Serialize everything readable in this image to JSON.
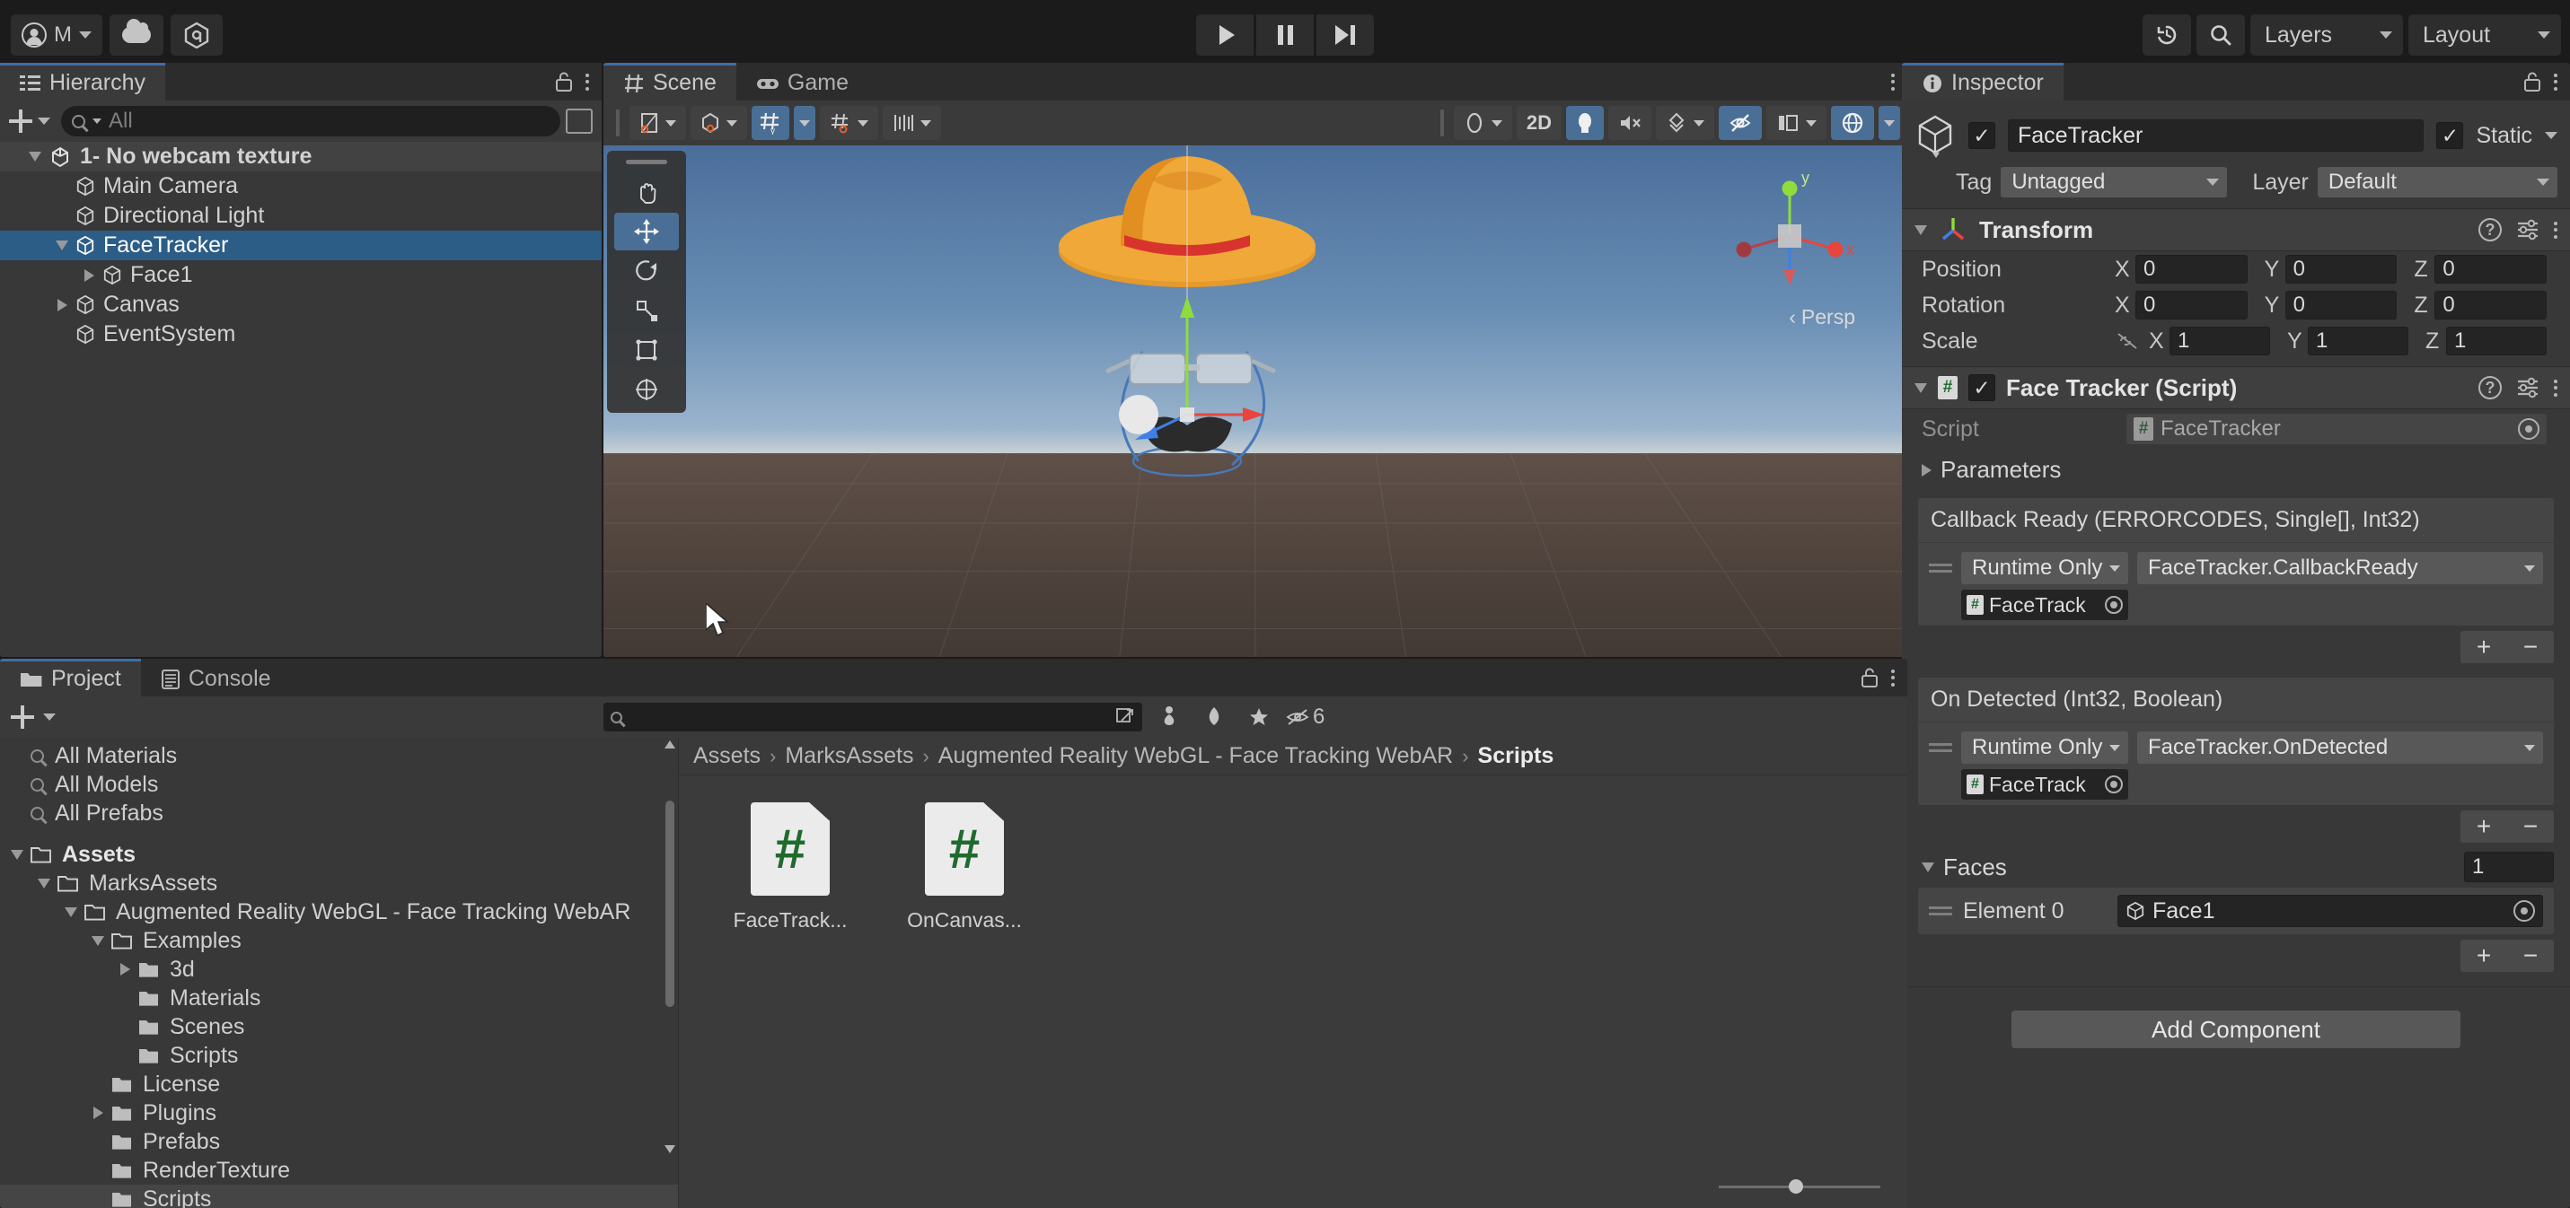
{
  "toolbar": {
    "account_label": "M",
    "account_icon": "user-avatar-icon",
    "cloud_icon": "cloud-icon",
    "services_icon": "unity-services-icon",
    "play_icon": "play-icon",
    "pause_icon": "pause-icon",
    "step_icon": "step-icon",
    "history_icon": "undo-history-icon",
    "search_icon": "search-icon",
    "layers_label": "Layers",
    "layout_label": "Layout"
  },
  "hierarchy": {
    "tab_label": "Hierarchy",
    "tab_icon": "hierarchy-icon",
    "lock_icon": "lock-icon",
    "menu_icon": "kebab-menu-icon",
    "add_icon": "plus-icon",
    "search_placeholder": "All",
    "search_value": "",
    "items": [
      {
        "label": "1- No webcam texture",
        "depth": 0,
        "icon": "unity-scene-icon",
        "expand": "down",
        "selected": false,
        "is_scene": true
      },
      {
        "label": "Main Camera",
        "depth": 1,
        "icon": "gameobject-icon",
        "expand": "none",
        "selected": false,
        "is_scene": false
      },
      {
        "label": "Directional Light",
        "depth": 1,
        "icon": "gameobject-icon",
        "expand": "none",
        "selected": false,
        "is_scene": false
      },
      {
        "label": "FaceTracker",
        "depth": 1,
        "icon": "gameobject-icon",
        "expand": "down",
        "selected": true,
        "is_scene": false
      },
      {
        "label": "Face1",
        "depth": 2,
        "icon": "gameobject-icon",
        "expand": "right",
        "selected": false,
        "is_scene": false
      },
      {
        "label": "Canvas",
        "depth": 1,
        "icon": "gameobject-icon",
        "expand": "right",
        "selected": false,
        "is_scene": false
      },
      {
        "label": "EventSystem",
        "depth": 1,
        "icon": "gameobject-icon",
        "expand": "none",
        "selected": false,
        "is_scene": false
      }
    ]
  },
  "scene": {
    "tabs": [
      {
        "label": "Scene",
        "icon": "scene-grid-icon",
        "active": true
      },
      {
        "label": "Game",
        "icon": "game-controller-icon",
        "active": false
      }
    ],
    "menu_icon": "kebab-menu-icon",
    "left_tools": [
      {
        "name": "hand-tool",
        "active": false
      },
      {
        "name": "move-tool",
        "active": true
      },
      {
        "name": "rotate-tool",
        "active": false
      },
      {
        "name": "scale-tool",
        "active": false
      },
      {
        "name": "rect-tool",
        "active": false
      },
      {
        "name": "transform-tool",
        "active": false
      }
    ],
    "toolbar_left": [
      {
        "name": "tool-settings-pivot",
        "active": false,
        "has_caret": true
      },
      {
        "name": "tool-settings-handle",
        "active": false,
        "has_caret": true
      },
      {
        "name": "grid-snapping",
        "active": true,
        "has_caret": true
      },
      {
        "name": "grid-visibility",
        "active": false,
        "has_caret": true
      },
      {
        "name": "snap-increment",
        "active": false,
        "has_caret": true
      }
    ],
    "toolbar_right": [
      {
        "name": "draw-mode",
        "active": false,
        "has_caret": true
      },
      {
        "name": "2d-toggle",
        "label": "2D",
        "active": false,
        "has_caret": false
      },
      {
        "name": "scene-lighting",
        "active": true,
        "has_caret": false
      },
      {
        "name": "scene-audio",
        "active": false,
        "has_caret": false
      },
      {
        "name": "effects-toggle",
        "active": false,
        "has_caret": true
      },
      {
        "name": "hidden-objects",
        "active": true,
        "has_caret": false
      },
      {
        "name": "scene-camera",
        "active": false,
        "has_caret": true
      },
      {
        "name": "gizmos-toggle",
        "active": true,
        "has_caret": true
      }
    ],
    "gizmo": {
      "x_label": "x",
      "y_label": "y",
      "persp_label": "Persp"
    }
  },
  "inspector": {
    "tab_label": "Inspector",
    "tab_icon": "info-icon",
    "lock_icon": "lock-icon",
    "menu_icon": "kebab-menu-icon",
    "object_icon": "gameobject-icon",
    "object_enabled": true,
    "object_name": "FaceTracker",
    "static_label": "Static",
    "static_checked": true,
    "tag_label": "Tag",
    "tag_value": "Untagged",
    "layer_label": "Layer",
    "layer_value": "Default",
    "transform": {
      "title": "Transform",
      "icon": "transform-axis-icon",
      "help_icon": "help-icon",
      "preset_icon": "preset-icon",
      "menu_icon": "kebab-menu-icon",
      "rows": [
        {
          "label": "Position",
          "x": "0",
          "y": "0",
          "z": "0",
          "has_link": false
        },
        {
          "label": "Rotation",
          "x": "0",
          "y": "0",
          "z": "0",
          "has_link": false
        },
        {
          "label": "Scale",
          "x": "1",
          "y": "1",
          "z": "1",
          "has_link": true,
          "link_icon": "unlinked-scale-icon"
        }
      ],
      "axis_labels": {
        "x": "X",
        "y": "Y",
        "z": "Z"
      }
    },
    "script_component": {
      "title": "Face Tracker (Script)",
      "icon": "cs-script-icon",
      "enabled": true,
      "help_icon": "help-icon",
      "preset_icon": "preset-icon",
      "menu_icon": "kebab-menu-icon",
      "script_label": "Script",
      "script_value": "FaceTracker",
      "script_picker_icon": "object-picker-icon",
      "parameters_label": "Parameters",
      "parameters_expand": "right"
    },
    "events": [
      {
        "title": "Callback Ready (ERRORCODES, Single[], Int32)",
        "mode": "Runtime Only",
        "function": "FaceTracker.CallbackReady",
        "target_object": "FaceTrack",
        "target_icon": "cs-script-icon",
        "picker_icon": "object-picker-icon",
        "add_label": "+",
        "remove_label": "−"
      },
      {
        "title": "On Detected (Int32, Boolean)",
        "mode": "Runtime Only",
        "function": "FaceTracker.OnDetected",
        "target_object": "FaceTrack",
        "target_icon": "cs-script-icon",
        "picker_icon": "object-picker-icon",
        "add_label": "+",
        "remove_label": "−"
      }
    ],
    "faces": {
      "label": "Faces",
      "expand": "down",
      "count": "1",
      "elements": [
        {
          "label": "Element 0",
          "value": "Face1",
          "icon": "gameobject-icon",
          "picker_icon": "object-picker-icon"
        }
      ],
      "add_label": "+",
      "remove_label": "−"
    },
    "add_component_label": "Add Component"
  },
  "project": {
    "tabs": [
      {
        "label": "Project",
        "icon": "folder-icon",
        "active": true
      },
      {
        "label": "Console",
        "icon": "console-icon",
        "active": false
      }
    ],
    "lock_icon": "lock-icon",
    "menu_icon": "kebab-menu-icon",
    "add_icon": "plus-icon",
    "search_placeholder": "",
    "search_value": "",
    "search_icon": "search-icon",
    "filter_icons": [
      {
        "name": "expand-search-icon"
      },
      {
        "name": "filter-type-icon"
      },
      {
        "name": "filter-label-icon"
      },
      {
        "name": "favorites-star-icon"
      }
    ],
    "hidden_count_icon": "hidden-packages-icon",
    "hidden_count": "6",
    "saved_searches": [
      {
        "label": "All Materials",
        "icon": "search-icon"
      },
      {
        "label": "All Models",
        "icon": "search-icon"
      },
      {
        "label": "All Prefabs",
        "icon": "search-icon"
      }
    ],
    "tree": [
      {
        "label": "Assets",
        "depth": 0,
        "expand": "down",
        "bold": true,
        "open_folder": true,
        "highlight": false
      },
      {
        "label": "MarksAssets",
        "depth": 1,
        "expand": "down",
        "bold": false,
        "open_folder": true,
        "highlight": false
      },
      {
        "label": "Augmented Reality WebGL - Face Tracking WebAR",
        "depth": 2,
        "expand": "down",
        "bold": false,
        "open_folder": true,
        "highlight": false
      },
      {
        "label": "Examples",
        "depth": 3,
        "expand": "down",
        "bold": false,
        "open_folder": true,
        "highlight": false
      },
      {
        "label": "3d",
        "depth": 4,
        "expand": "right",
        "bold": false,
        "open_folder": false,
        "highlight": false
      },
      {
        "label": "Materials",
        "depth": 4,
        "expand": "none",
        "bold": false,
        "open_folder": false,
        "highlight": false
      },
      {
        "label": "Scenes",
        "depth": 4,
        "expand": "none",
        "bold": false,
        "open_folder": false,
        "highlight": false
      },
      {
        "label": "Scripts",
        "depth": 4,
        "expand": "none",
        "bold": false,
        "open_folder": false,
        "highlight": false
      },
      {
        "label": "License",
        "depth": 3,
        "expand": "none",
        "bold": false,
        "open_folder": false,
        "highlight": false
      },
      {
        "label": "Plugins",
        "depth": 3,
        "expand": "right",
        "bold": false,
        "open_folder": false,
        "highlight": false
      },
      {
        "label": "Prefabs",
        "depth": 3,
        "expand": "none",
        "bold": false,
        "open_folder": false,
        "highlight": false
      },
      {
        "label": "RenderTexture",
        "depth": 3,
        "expand": "none",
        "bold": false,
        "open_folder": false,
        "highlight": false
      },
      {
        "label": "Scripts",
        "depth": 3,
        "expand": "none",
        "bold": false,
        "open_folder": false,
        "highlight": true
      }
    ],
    "breadcrumb": [
      {
        "label": "Assets",
        "current": false
      },
      {
        "label": "MarksAssets",
        "current": false
      },
      {
        "label": "Augmented Reality WebGL - Face Tracking WebAR",
        "current": false
      },
      {
        "label": "Scripts",
        "current": true
      }
    ],
    "breadcrumb_separator": "›",
    "assets": [
      {
        "name": "FaceTrack...",
        "type": "cs-script",
        "glyph": "#"
      },
      {
        "name": "OnCanvas...",
        "type": "cs-script",
        "glyph": "#"
      }
    ]
  },
  "colors": {
    "panel_bg": "#383838",
    "toolbar_bg": "#1b1b1b",
    "selection_blue": "#2c5d87",
    "accent_blue": "#4a6f96",
    "tab_underline": "#3e6ea8",
    "text": "#c8c8c8",
    "field_bg": "#242424",
    "dropdown_bg": "#585858",
    "script_green": "#1f6b2e"
  }
}
